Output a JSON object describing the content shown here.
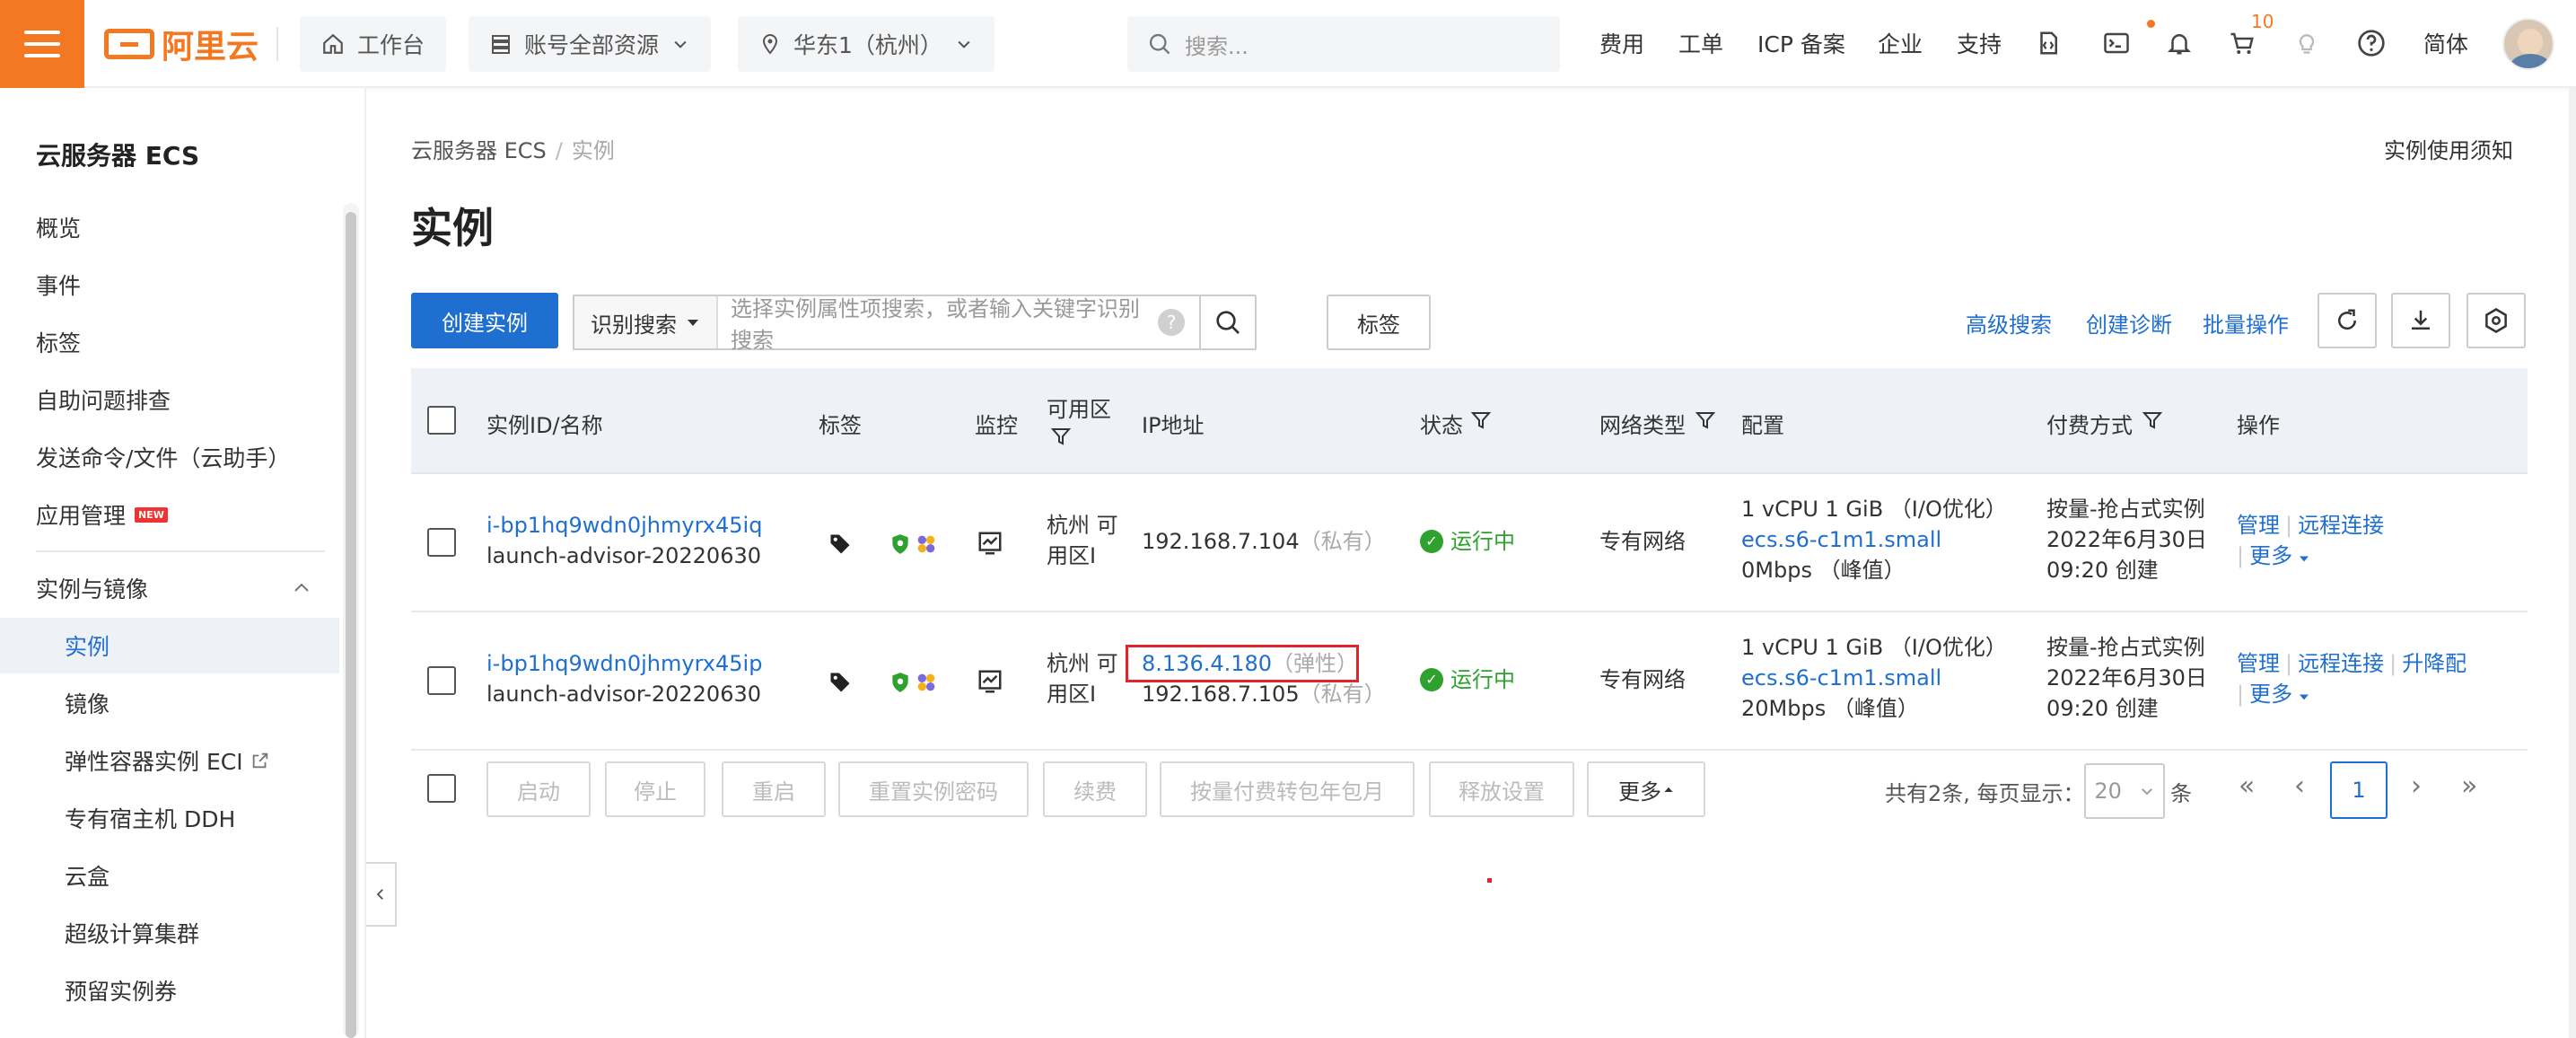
{
  "topbar": {
    "logo_text": "阿里云",
    "workbench": "工作台",
    "account_resources": "账号全部资源",
    "region": "华东1（杭州）",
    "search_placeholder": "搜索...",
    "nav": [
      "费用",
      "工单",
      "ICP 备案",
      "企业",
      "支持"
    ],
    "cart_count": "10",
    "language": "简体"
  },
  "sidebar": {
    "title": "云服务器 ECS",
    "items": [
      {
        "label": "概览"
      },
      {
        "label": "事件"
      },
      {
        "label": "标签"
      },
      {
        "label": "自助问题排查"
      },
      {
        "label": "发送命令/文件（云助手）"
      },
      {
        "label": "应用管理",
        "badge": "NEW"
      }
    ],
    "group_title": "实例与镜像",
    "group_items": [
      {
        "label": "实例"
      },
      {
        "label": "镜像"
      },
      {
        "label": "弹性容器实例 ECI"
      },
      {
        "label": "专有宿主机 DDH"
      },
      {
        "label": "云盒"
      },
      {
        "label": "超级计算集群"
      },
      {
        "label": "预留实例券"
      }
    ]
  },
  "breadcrumb": {
    "root": "云服务器 ECS",
    "current": "实例"
  },
  "page_notice": "实例使用须知",
  "page_title": "实例",
  "toolbar": {
    "create": "创建实例",
    "filter_type": "识别搜索",
    "filter_placeholder": "选择实例属性项搜索，或者输入关键字识别搜索",
    "tag_button": "标签",
    "advanced_search": "高级搜索",
    "create_diagnosis": "创建诊断",
    "batch_ops": "批量操作"
  },
  "table": {
    "headers": {
      "id": "实例ID/名称",
      "tags": "标签",
      "monitor": "监控",
      "zone": "可用区",
      "ip": "IP地址",
      "status": "状态",
      "network": "网络类型",
      "config": "配置",
      "billing": "付费方式",
      "actions": "操作"
    },
    "rows": [
      {
        "id": "i-bp1hq9wdn0jhmyrx45iq",
        "name": "launch-advisor-20220630",
        "zone_1": "杭州 可",
        "zone_2": "用区I",
        "ip_private": "192.168.7.104",
        "ip_private_tag": "（私有）",
        "status": "运行中",
        "network": "专有网络",
        "config_1": "1 vCPU 1 GiB （I/O优化）",
        "config_2": "ecs.s6-c1m1.small",
        "config_3": "0Mbps （峰值）",
        "billing_1": "按量-抢占式实例",
        "billing_2": "2022年6月30日",
        "billing_3": "09:20 创建",
        "action_manage": "管理",
        "action_remote": "远程连接",
        "action_more": "更多"
      },
      {
        "id": "i-bp1hq9wdn0jhmyrx45ip",
        "name": "launch-advisor-20220630",
        "zone_1": "杭州 可",
        "zone_2": "用区I",
        "ip_public": "8.136.4.180",
        "ip_public_tag": "（弹性）",
        "ip_private": "192.168.7.105",
        "ip_private_tag": "（私有）",
        "status": "运行中",
        "network": "专有网络",
        "config_1": "1 vCPU 1 GiB （I/O优化）",
        "config_2": "ecs.s6-c1m1.small",
        "config_3": "20Mbps （峰值）",
        "billing_1": "按量-抢占式实例",
        "billing_2": "2022年6月30日",
        "billing_3": "09:20 创建",
        "action_manage": "管理",
        "action_remote": "远程连接",
        "action_upgrade": "升降配",
        "action_more": "更多"
      }
    ]
  },
  "footer": {
    "buttons": [
      "启动",
      "停止",
      "重启",
      "重置实例密码",
      "续费",
      "按量付费转包年包月",
      "释放设置"
    ],
    "more": "更多",
    "total_text": "共有2条, 每页显示：",
    "page_size": "20",
    "unit": "条",
    "current_page": "1"
  }
}
